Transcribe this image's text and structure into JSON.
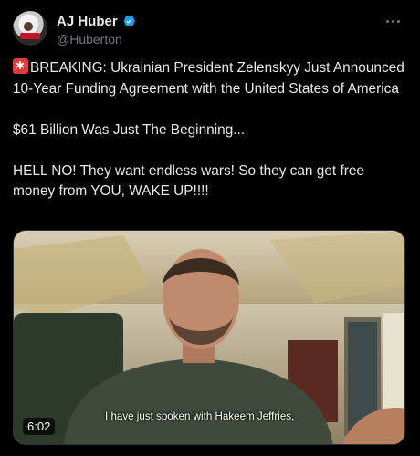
{
  "author": {
    "display_name": "AJ Huber",
    "handle": "@Huberton",
    "verified": true,
    "verified_color": "#1d9bf0"
  },
  "icons": {
    "avatar": "profile-avatar",
    "verified": "verified-badge-icon",
    "more": "more-options-icon",
    "siren": "police-light-emoji"
  },
  "tweet": {
    "paragraph_1": "BREAKING: Ukrainian President Zelenskyy Just Announced 10-Year Funding Agreement with the United States of America",
    "paragraph_2": "$61 Billion Was Just The Beginning...",
    "paragraph_3": "HELL NO! They want endless wars! So they can get free money from YOU, WAKE UP!!!!"
  },
  "media": {
    "type": "video",
    "duration": "6:02",
    "caption": "I have just spoken with Hakeem Jeffries,"
  },
  "colors": {
    "background": "#000000",
    "text_primary": "#e7e9ea",
    "text_secondary": "#71767b",
    "border": "#2f3336"
  }
}
